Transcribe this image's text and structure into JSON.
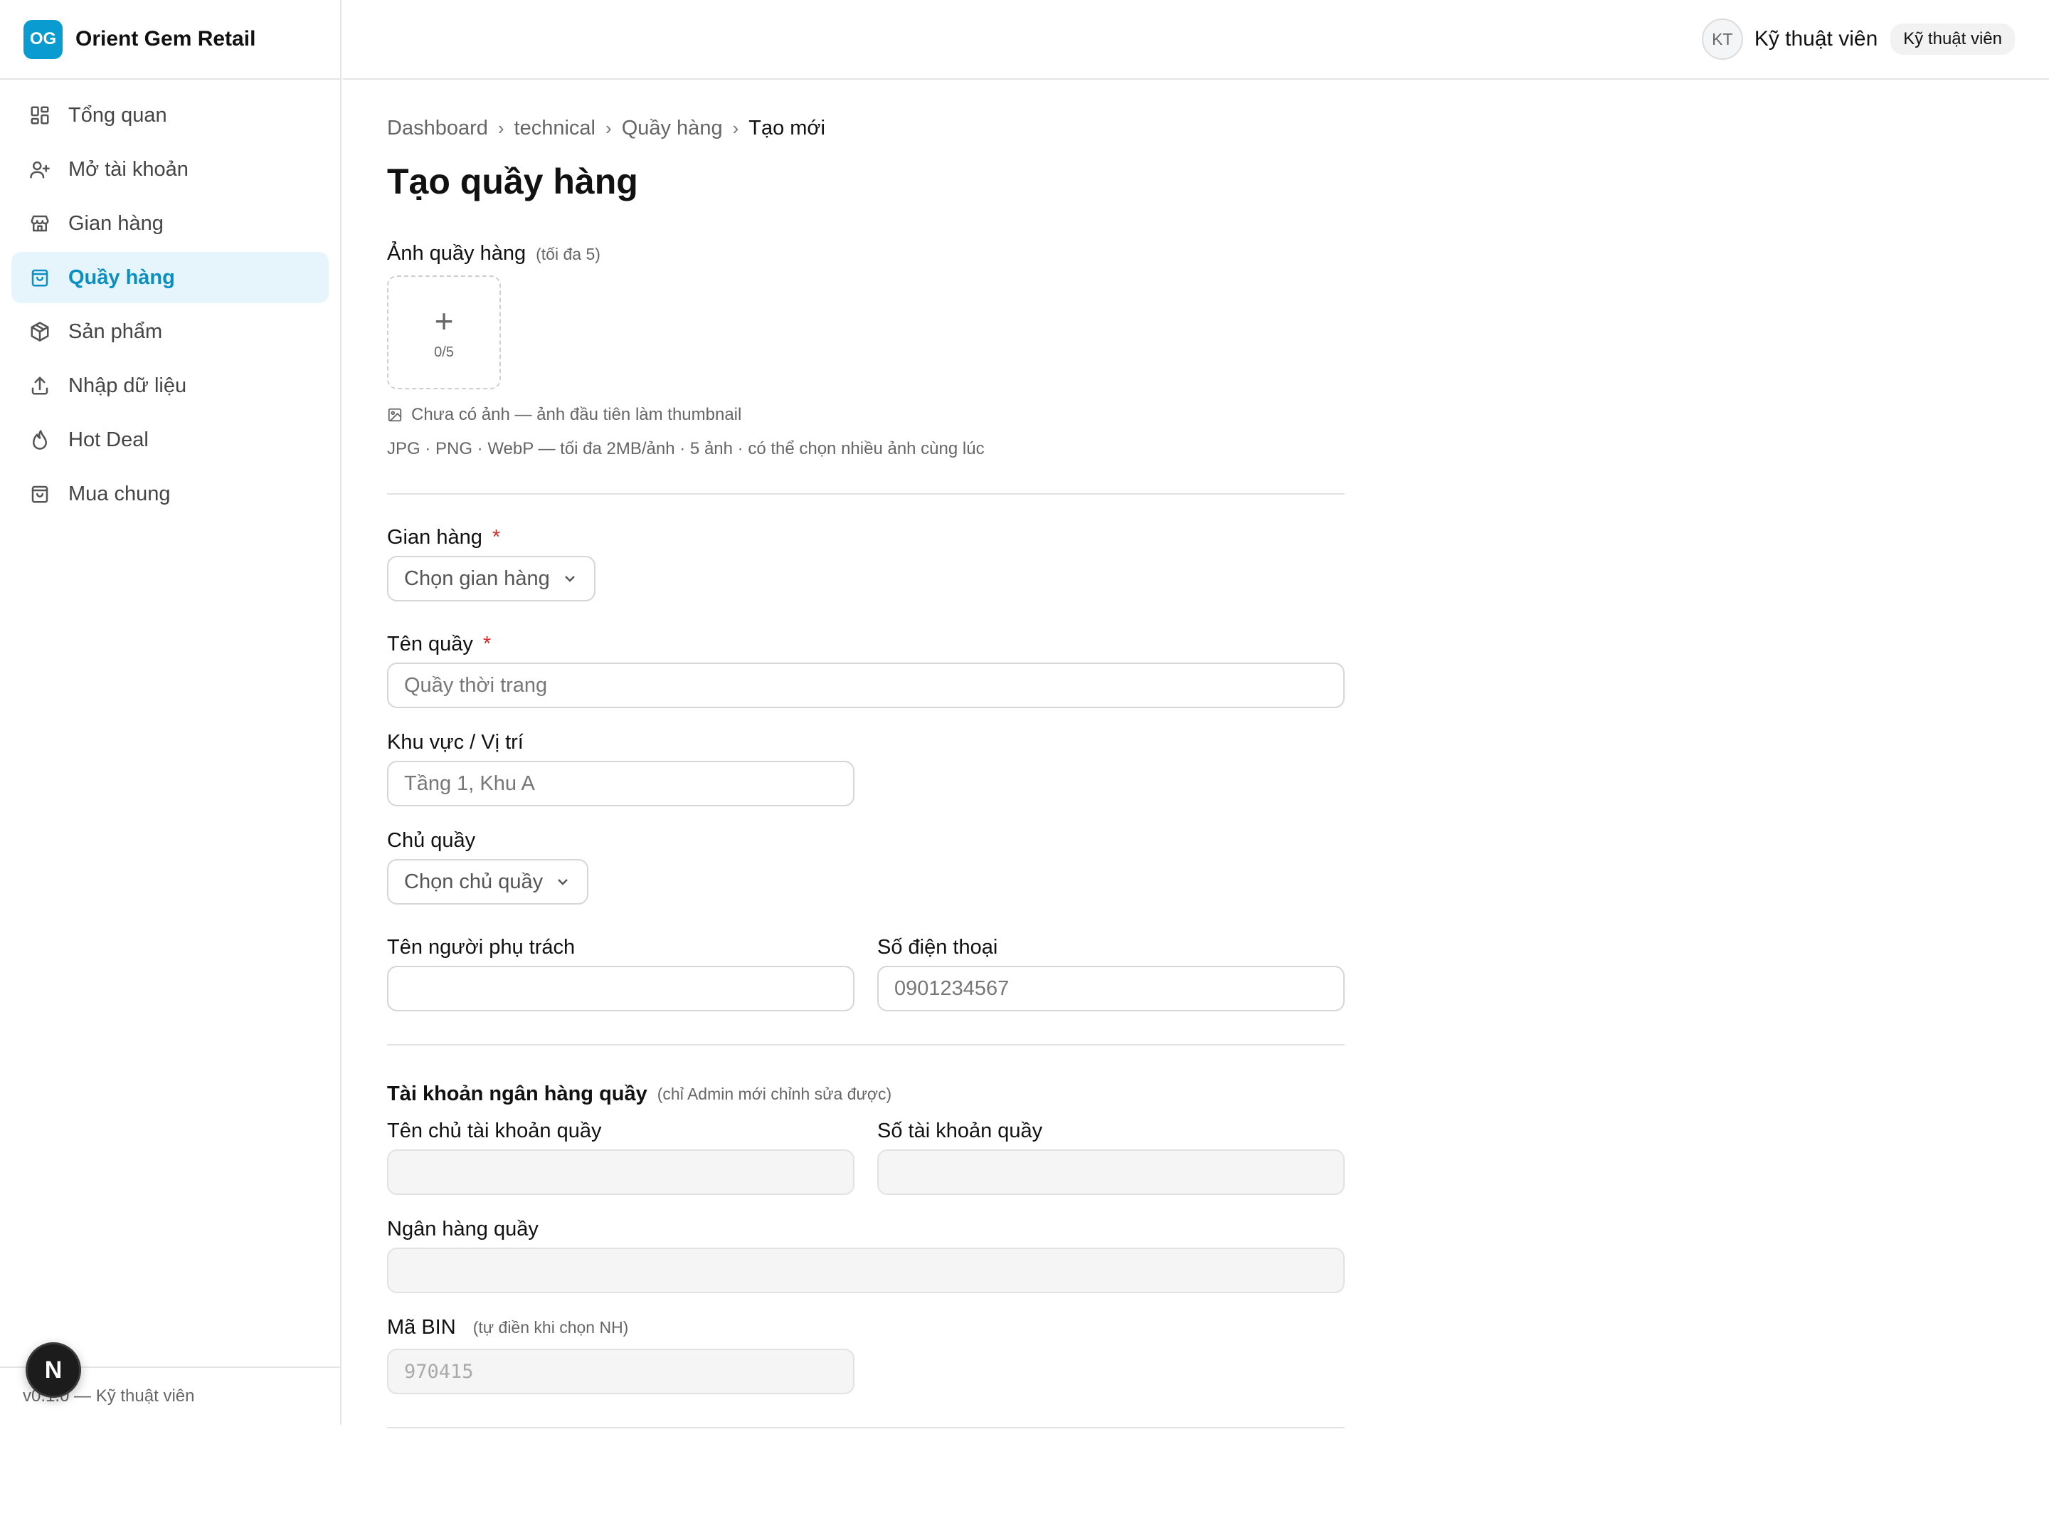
{
  "brand": {
    "logo": "OG",
    "name": "Orient Gem Retail"
  },
  "sidebar": {
    "items": [
      {
        "label": "Tổng quan",
        "icon": "dashboard-icon",
        "active": false
      },
      {
        "label": "Mở tài khoản",
        "icon": "user-plus-icon",
        "active": false
      },
      {
        "label": "Gian hàng",
        "icon": "store-icon",
        "active": false
      },
      {
        "label": "Quầy hàng",
        "icon": "shopping-bag-icon",
        "active": true
      },
      {
        "label": "Sản phẩm",
        "icon": "package-icon",
        "active": false
      },
      {
        "label": "Nhập dữ liệu",
        "icon": "upload-icon",
        "active": false
      },
      {
        "label": "Hot Deal",
        "icon": "flame-icon",
        "active": false
      },
      {
        "label": "Mua chung",
        "icon": "shopping-bag-icon",
        "active": false
      }
    ],
    "footer": "v0.1.0 — Kỹ thuật viên",
    "n_badge": "N"
  },
  "header": {
    "avatar": "KT",
    "user_name": "Kỹ thuật viên",
    "role": "Kỹ thuật viên"
  },
  "breadcrumb": [
    "Dashboard",
    "technical",
    "Quầy hàng",
    "Tạo mới"
  ],
  "page_title": "Tạo quầy hàng",
  "upload": {
    "label": "Ảnh quầy hàng",
    "hint": "(tối đa 5)",
    "count": "0/5",
    "note": "Chưa có ảnh — ảnh đầu tiên làm thumbnail",
    "formats": "JPG · PNG · WebP — tối đa 2MB/ảnh · 5 ảnh · có thể chọn nhiều ảnh cùng lúc"
  },
  "form": {
    "store_label": "Gian hàng",
    "store_placeholder": "Chọn gian hàng",
    "required_mark": "*",
    "counter_name_label": "Tên quầy",
    "counter_name_placeholder": "Quầy thời trang",
    "area_label": "Khu vực / Vị trí",
    "area_placeholder": "Tầng 1, Khu A",
    "owner_label": "Chủ quầy",
    "owner_placeholder": "Chọn chủ quầy",
    "manager_label": "Tên người phụ trách",
    "manager_value": "",
    "phone_label": "Số điện thoại",
    "phone_placeholder": "0901234567"
  },
  "bank": {
    "title": "Tài khoản ngân hàng quầy",
    "hint": "(chỉ Admin mới chỉnh sửa được)",
    "holder_label": "Tên chủ tài khoản quầy",
    "holder_value": "",
    "account_label": "Số tài khoản quầy",
    "account_value": "",
    "bank_label": "Ngân hàng quầy",
    "bank_value": "",
    "bin_label": "Mã BIN",
    "bin_hint": "(tự điền khi chọn NH)",
    "bin_placeholder": "970415"
  },
  "colors": {
    "accent": "#0a9bd0",
    "active_bg": "#e6f5fb",
    "required": "#d62828"
  }
}
